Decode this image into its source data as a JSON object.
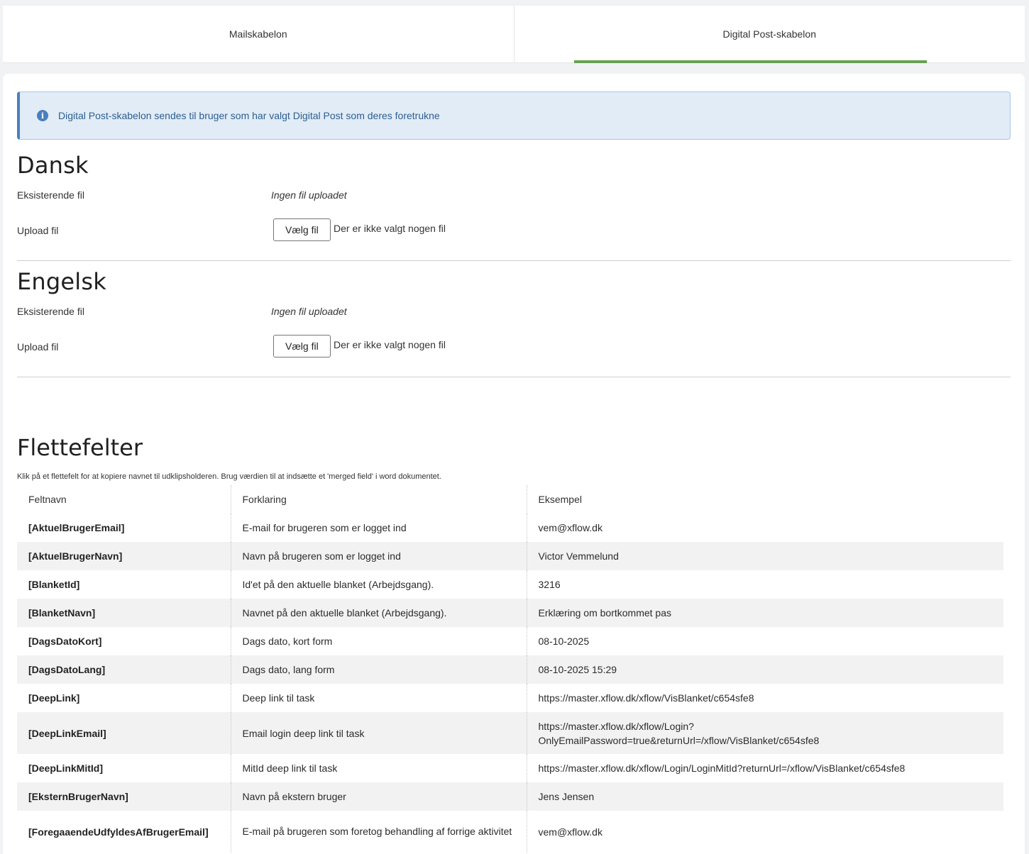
{
  "tabs": [
    {
      "label": "Mailskabelon",
      "active": false
    },
    {
      "label": "Digital Post-skabelon",
      "active": true
    }
  ],
  "info": {
    "text": "Digital Post-skabelon sendes til bruger som har valgt Digital Post som deres foretrukne",
    "icon": "info-icon"
  },
  "sections": [
    {
      "title": "Dansk",
      "existing_label": "Eksisterende fil",
      "existing_value": "Ingen fil uploadet",
      "upload_label": "Upload fil",
      "choose_button": "Vælg fil",
      "file_status": "Der er ikke valgt nogen fil"
    },
    {
      "title": "Engelsk",
      "existing_label": "Eksisterende fil",
      "existing_value": "Ingen fil uploadet",
      "upload_label": "Upload fil",
      "choose_button": "Vælg fil",
      "file_status": "Der er ikke valgt nogen fil"
    }
  ],
  "merge": {
    "title": "Flettefelter",
    "hint": "Klik på et flettefelt for at kopiere navnet til udklipsholderen. Brug værdien til at indsætte et 'merged field' i word dokumentet.",
    "columns": [
      "Feltnavn",
      "Forklaring",
      "Eksempel"
    ],
    "rows": [
      [
        "[AktuelBrugerEmail]",
        "E-mail for brugeren som er logget ind",
        "vem@xflow.dk"
      ],
      [
        "[AktuelBrugerNavn]",
        "Navn på brugeren som er logget ind",
        "Victor Vemmelund"
      ],
      [
        "[BlanketId]",
        "Id'et på den aktuelle blanket (Arbejdsgang).",
        "3216"
      ],
      [
        "[BlanketNavn]",
        "Navnet på den aktuelle blanket (Arbejdsgang).",
        "Erklæring om bortkommet pas"
      ],
      [
        "[DagsDatoKort]",
        "Dags dato, kort form",
        "08-10-2025"
      ],
      [
        "[DagsDatoLang]",
        "Dags dato, lang form",
        "08-10-2025 15:29"
      ],
      [
        "[DeepLink]",
        "Deep link til task",
        "https://master.xflow.dk/xflow/VisBlanket/c654sfe8"
      ],
      [
        "[DeepLinkEmail]",
        "Email login deep link til task",
        "https://master.xflow.dk/xflow/Login?\nOnlyEmailPassword=true&returnUrl=/xflow/VisBlanket/c654sfe8"
      ],
      [
        "[DeepLinkMitId]",
        "MitId deep link til task",
        "https://master.xflow.dk/xflow/Login/LoginMitId?returnUrl=/xflow/VisBlanket/c654sfe8"
      ],
      [
        "[EksternBrugerNavn]",
        "Navn på ekstern bruger",
        "Jens Jensen"
      ],
      [
        "[ForegaaendeUdfyldesAfBrugerEmail]",
        "E-mail på brugeren som foretog behandling af forrige aktivitet",
        "vem@xflow.dk"
      ]
    ]
  }
}
